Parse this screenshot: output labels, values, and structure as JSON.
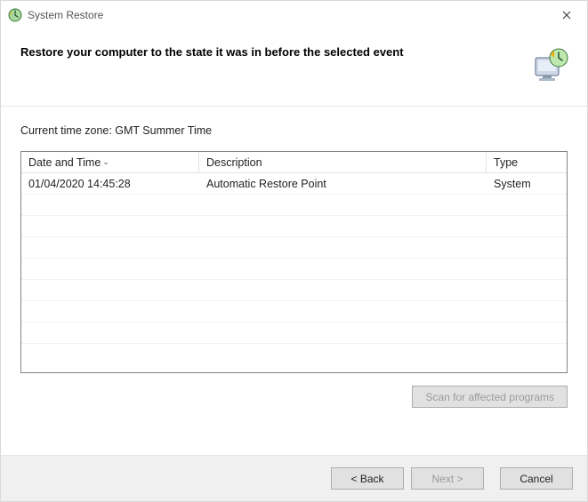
{
  "window": {
    "title": "System Restore"
  },
  "header": {
    "headline": "Restore your computer to the state it was in before the selected event"
  },
  "body": {
    "timezone_label": "Current time zone: GMT Summer Time",
    "columns": {
      "date": "Date and Time",
      "desc": "Description",
      "type": "Type"
    },
    "rows": [
      {
        "date": "01/04/2020 14:45:28",
        "desc": "Automatic Restore Point",
        "type": "System"
      }
    ],
    "scan_button": "Scan for affected programs"
  },
  "footer": {
    "back": "< Back",
    "next": "Next >",
    "cancel": "Cancel"
  }
}
